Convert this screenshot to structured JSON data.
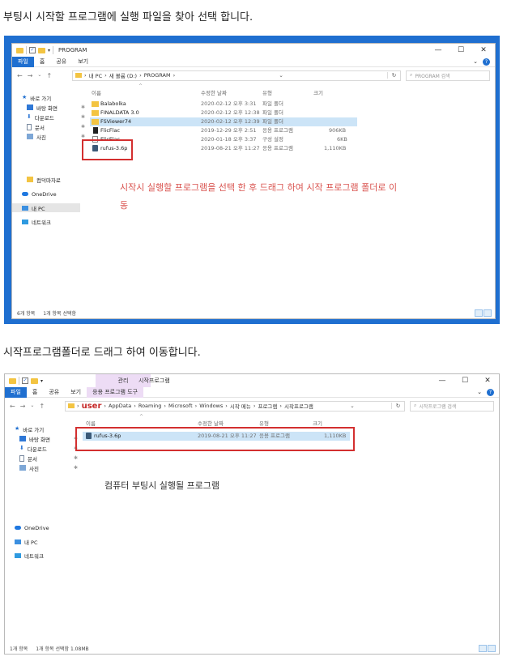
{
  "caption1": "부팅시 시작할 프로그램에 실행 파일을 찾아 선택 합니다.",
  "caption2": "시작프로그램폴더로 드래그 하여 이동합니다.",
  "shot1": {
    "title": "PROGRAM",
    "ribbon_tabs": [
      "파일",
      "홈",
      "공유",
      "보기"
    ],
    "window_controls": [
      "—",
      "☐",
      "✕"
    ],
    "breadcrumb": [
      "내 PC",
      "새 볼륨 (D:)",
      "PROGRAM"
    ],
    "search_placeholder": "PROGRAM 검색",
    "nav_items": [
      {
        "label": "바로 가기",
        "icon": "star-icon"
      },
      {
        "label": "바탕 화면",
        "icon": "desktop-icon",
        "pinned": true
      },
      {
        "label": "다운로드",
        "icon": "download-icon",
        "pinned": true
      },
      {
        "label": "문서",
        "icon": "documents-icon",
        "pinned": true
      },
      {
        "label": "사진",
        "icon": "pictures-icon",
        "pinned": true
      },
      {
        "label": "컴덕마자료",
        "icon": "folder-icon"
      },
      {
        "label": "OneDrive",
        "icon": "onedrive-icon"
      },
      {
        "label": "내 PC",
        "icon": "this-pc-icon"
      },
      {
        "label": "네트워크",
        "icon": "network-icon"
      }
    ],
    "columns": [
      "이름",
      "수정한 날짜",
      "유형",
      "크기"
    ],
    "files": [
      {
        "name": "Balabolka",
        "date": "2020-02-12 오후 3:31",
        "type": "파일 폴더",
        "size": "",
        "icon": "folder-icon"
      },
      {
        "name": "FINALDATA 3.0",
        "date": "2020-02-12 오후 12:38",
        "type": "파일 폴더",
        "size": "",
        "icon": "folder-icon"
      },
      {
        "name": "FSViewer74",
        "date": "2020-02-12 오후 12:39",
        "type": "파일 폴더",
        "size": "",
        "icon": "folder-icon"
      },
      {
        "name": "FlicFlac",
        "date": "2019-12-29 오후 2:51",
        "type": "응용 프로그램",
        "size": "906KB",
        "icon": "flac-app-icon"
      },
      {
        "name": "FlicFlac",
        "date": "2020-01-18 오후 3:37",
        "type": "구성 설정",
        "size": "6KB",
        "icon": "config-file-icon"
      },
      {
        "name": "rufus-3.6p",
        "date": "2019-08-21 오후 11:27",
        "type": "응용 프로그램",
        "size": "1,110KB",
        "icon": "usb-app-icon"
      }
    ],
    "status_count": "6개 항목",
    "status_selected": "1개 항목 선택함",
    "note_line1": "시작시 실행할 프로그램을  선택 한 후 드래그 하여 시작 프로그램 폴더로 이",
    "note_line2": "동"
  },
  "shot2": {
    "context_tab": "관리",
    "title": "시작프로그램",
    "ribbon_tabs": [
      "파일",
      "홈",
      "공유",
      "보기",
      "응용 프로그램 도구"
    ],
    "window_controls": [
      "—",
      "☐",
      "✕"
    ],
    "breadcrumb_user": "user",
    "breadcrumb": [
      "AppData",
      "Roaming",
      "Microsoft",
      "Windows",
      "시작 메뉴",
      "프로그램",
      "시작프로그램"
    ],
    "search_placeholder": "시작프로그램 검색",
    "nav_items": [
      {
        "label": "바로 가기",
        "icon": "star-icon"
      },
      {
        "label": "바탕 화면",
        "icon": "desktop-icon",
        "pinned": true
      },
      {
        "label": "다운로드",
        "icon": "download-icon",
        "pinned": true
      },
      {
        "label": "문서",
        "icon": "documents-icon",
        "pinned": true
      },
      {
        "label": "사진",
        "icon": "pictures-icon",
        "pinned": true
      },
      {
        "label": "OneDrive",
        "icon": "onedrive-icon"
      },
      {
        "label": "내 PC",
        "icon": "this-pc-icon"
      },
      {
        "label": "네트워크",
        "icon": "network-icon"
      }
    ],
    "columns": [
      "이름",
      "수정한 날짜",
      "유형",
      "크기"
    ],
    "files": [
      {
        "name": "rufus-3.6p",
        "date": "2019-08-21 오후 11:27",
        "type": "응용 프로그램",
        "size": "1,110KB",
        "icon": "usb-app-icon"
      }
    ],
    "status_count": "1개 항목",
    "status_selected": "1개 항목 선택함 1.08MB",
    "note": "컴퓨터 부팅시 실행될 프로그램"
  },
  "colors": {
    "frame_blue": "#1f6fd0",
    "highlight_red": "#d32f2f",
    "note_red": "#d9534f",
    "selection": "#cce4f7"
  }
}
